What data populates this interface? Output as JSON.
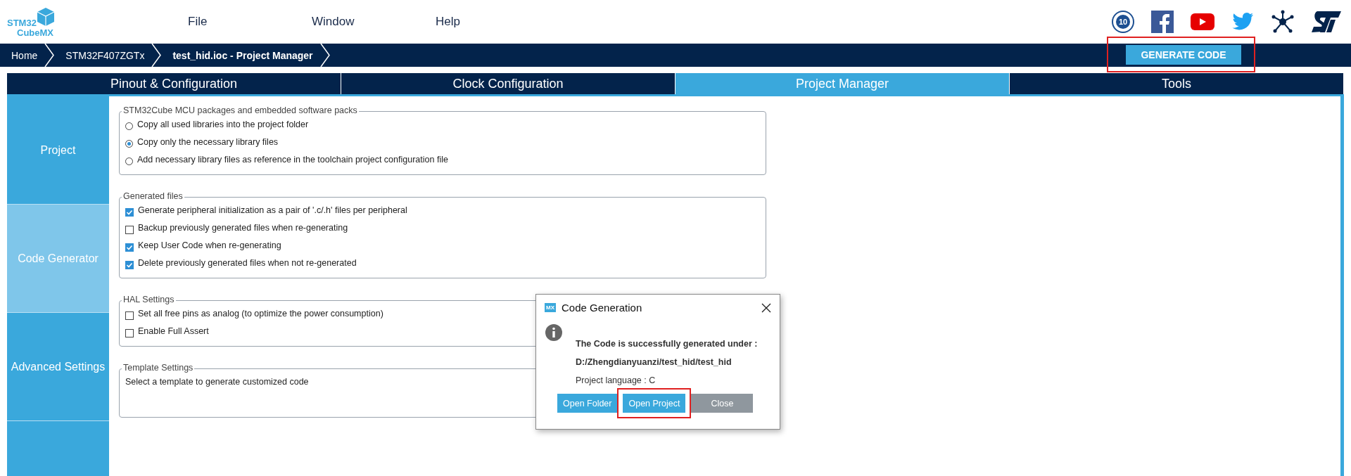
{
  "logo": {
    "line1": "STM32",
    "line2": "CubeMX"
  },
  "menu": [
    "File",
    "Window",
    "Help"
  ],
  "breadcrumb": [
    {
      "label": "Home",
      "selected": false
    },
    {
      "label": "STM32F407ZGTx",
      "selected": false
    },
    {
      "label": "test_hid.ioc - Project Manager",
      "selected": true
    }
  ],
  "generate_button": "GENERATE CODE",
  "badge_text": "10",
  "tabs": [
    {
      "label": "Pinout & Configuration",
      "selected": false
    },
    {
      "label": "Clock Configuration",
      "selected": false
    },
    {
      "label": "Project Manager",
      "selected": true
    },
    {
      "label": "Tools",
      "selected": false
    }
  ],
  "sidebar": [
    {
      "label": "Project",
      "selected": false
    },
    {
      "label": "Code Generator",
      "selected": true
    },
    {
      "label": "Advanced Settings",
      "selected": false
    }
  ],
  "groups": [
    {
      "title": "STM32Cube MCU packages and embedded software packs",
      "kind": "radio",
      "options": [
        {
          "label": "Copy all used libraries into the project folder",
          "selected": false
        },
        {
          "label": "Copy only the necessary library files",
          "selected": true
        },
        {
          "label": "Add necessary library files as reference in the toolchain project configuration file",
          "selected": false
        }
      ]
    },
    {
      "title": "Generated files",
      "kind": "checkbox",
      "options": [
        {
          "label": "Generate peripheral initialization as a pair of '.c/.h' files per peripheral",
          "checked": true
        },
        {
          "label": "Backup previously generated files when re-generating",
          "checked": false
        },
        {
          "label": "Keep User Code when re-generating",
          "checked": true
        },
        {
          "label": "Delete previously generated files when not re-generated",
          "checked": true
        }
      ]
    },
    {
      "title": "HAL Settings",
      "kind": "checkbox",
      "options": [
        {
          "label": "Set all free pins as analog (to optimize the power consumption)",
          "checked": false
        },
        {
          "label": "Enable Full Assert",
          "checked": false
        }
      ]
    },
    {
      "title": "Template Settings",
      "kind": "text",
      "text": "Select a template to generate customized code"
    }
  ],
  "dialog": {
    "icon_text": "MX",
    "title": "Code Generation",
    "message": "The Code is successfully generated under :",
    "path": "D:/Zhengdianyuanzi/test_hid/test_hid",
    "language": "Project language : C",
    "buttons": [
      {
        "label": "Open Folder",
        "kind": "primary",
        "highlighted": false
      },
      {
        "label": "Open Project",
        "kind": "primary",
        "highlighted": true
      },
      {
        "label": "Close",
        "kind": "secondary",
        "highlighted": false
      }
    ]
  }
}
